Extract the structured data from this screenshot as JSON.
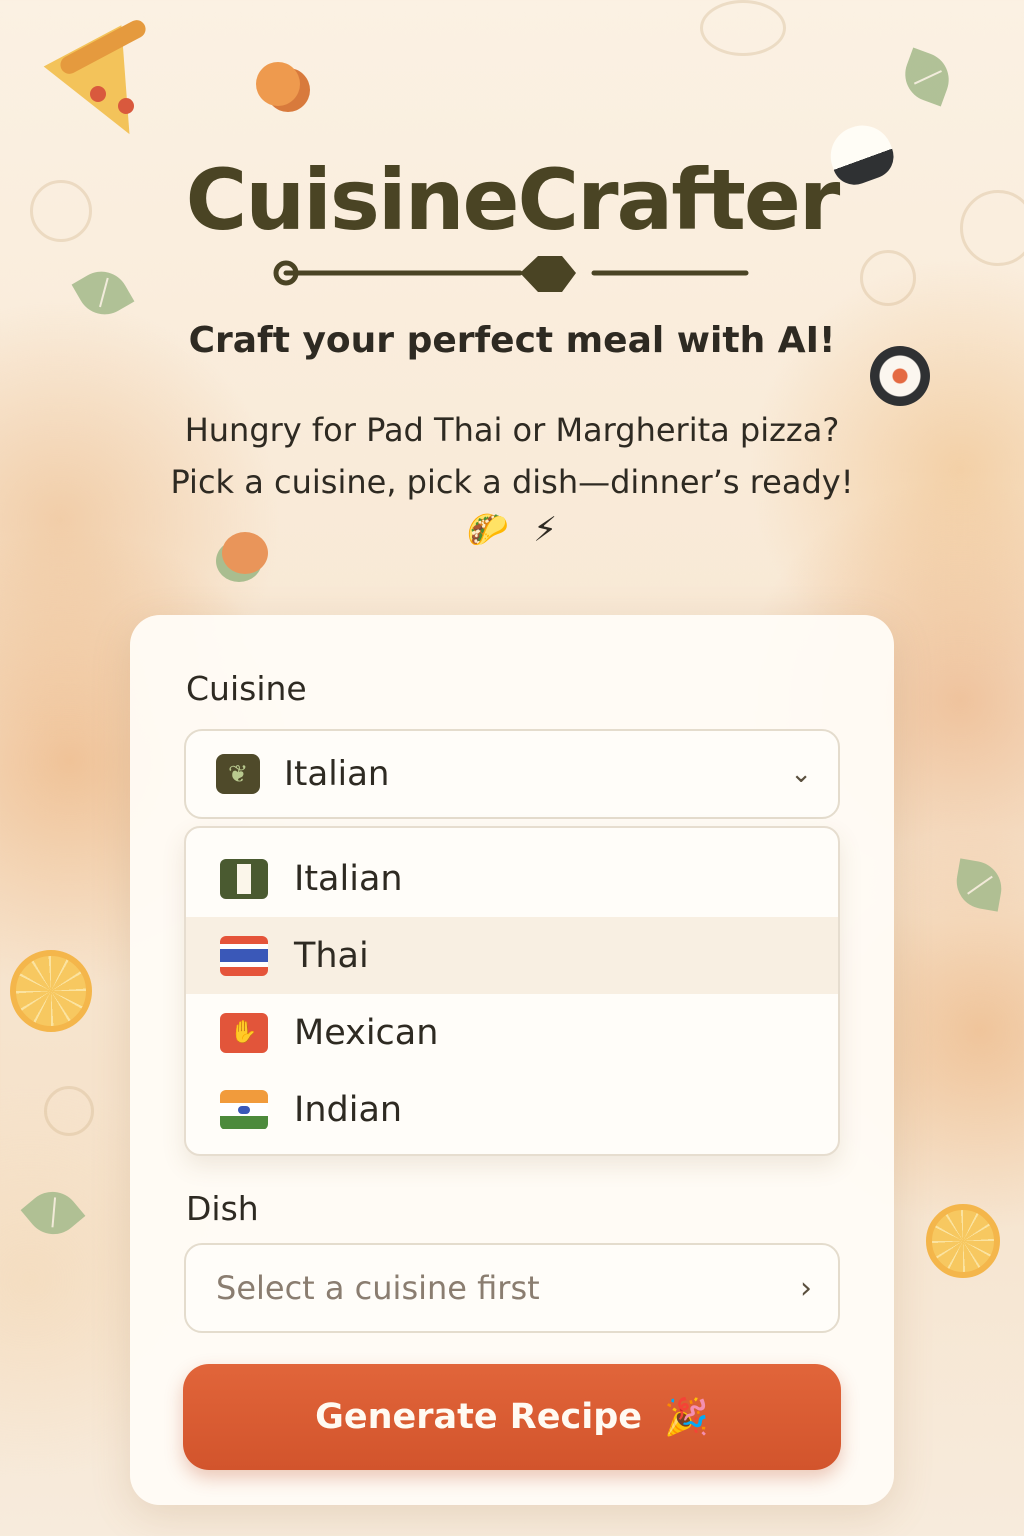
{
  "header": {
    "brand": "CuisineCrafter",
    "tagline": "Craft your perfect meal with AI!",
    "intro_line1": "Hungry for Pad Thai or Margherita pizza?",
    "intro_line2": "Pick a cuisine, pick a dish—dinner’s ready!",
    "intro_icons": [
      "taco-icon",
      "lightning-icon"
    ]
  },
  "form": {
    "cuisine_label": "Cuisine",
    "cuisine_selected": "Italian",
    "cuisine_options": [
      {
        "label": "Italian",
        "icon": "italian-flag-icon"
      },
      {
        "label": "Thai",
        "icon": "thai-flag-icon"
      },
      {
        "label": "Mexican",
        "icon": "mexican-flag-icon"
      },
      {
        "label": "Indian",
        "icon": "indian-flag-icon"
      }
    ],
    "dish_label": "Dish",
    "dish_placeholder": "Select a cuisine first",
    "generate_label": "Generate Recipe"
  },
  "colors": {
    "brand": "#4a4424",
    "accent": "#dc5c33",
    "background": "#fbf1e3"
  }
}
